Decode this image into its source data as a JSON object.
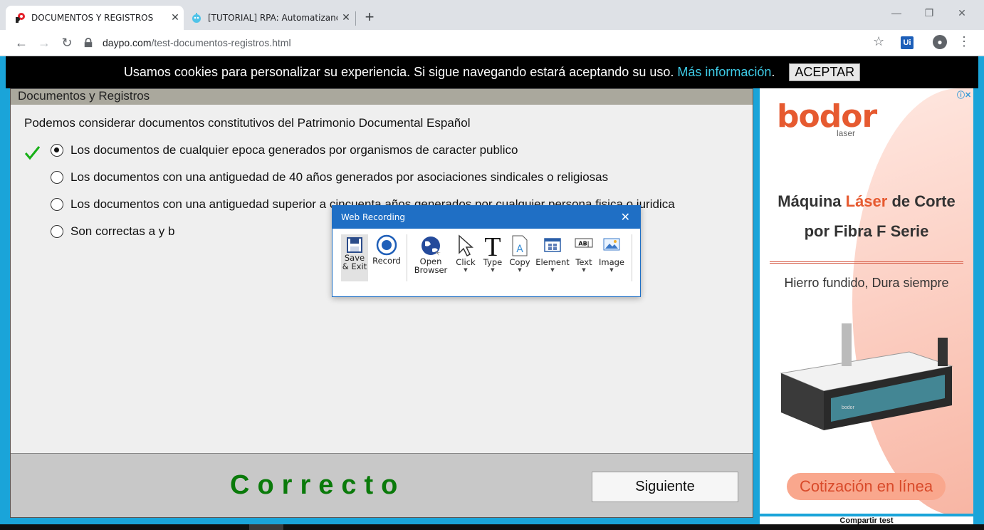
{
  "browser": {
    "tabs": [
      {
        "title": "DOCUMENTOS Y REGISTROS",
        "active": true
      },
      {
        "title": "[TUTORIAL] RPA: Automatizando",
        "active": false
      }
    ],
    "new_tab": "+",
    "url_host": "daypo.com",
    "url_path": "/test-documentos-registros.html",
    "ext_label": "Ui"
  },
  "cookie_bar": {
    "text": "Usamos cookies para personalizar su experiencia. Si sigue navegando estará aceptando su uso.",
    "more_link": "Más información",
    "period": ".",
    "accept_label": "ACEPTAR"
  },
  "quiz": {
    "header": "Documentos y Registros",
    "question": "Podemos considerar documentos constitutivos del Patrimonio Documental Español",
    "options": [
      "Los documentos de cualquier epoca generados por organismos de caracter publico",
      "Los documentos con una antiguedad de 40 años generados por asociaciones sindicales o religiosas",
      "Los documentos con una antiguedad superior a cincuenta años generados por cualquier persona fisica o juridica",
      "Son correctas a y b"
    ],
    "selected_index": 0,
    "result": "Correcto",
    "next_label": "Siguiente"
  },
  "ad": {
    "brand": "bodor",
    "brand_sub": "laser",
    "headline_1a": "Máquina ",
    "headline_1b": "Láser",
    "headline_1c": " de Corte",
    "headline_2": "por Fibra F Serie",
    "subtitle": "Hierro fundido, Dura siempre",
    "cta": "Cotización en línea",
    "accent_color": "#e65a30",
    "machine_label": "bodor"
  },
  "share_label": "Compartir test",
  "recorder": {
    "title": "Web Recording",
    "tools": {
      "save": "Save & Exit",
      "record": "Record",
      "open_browser": "Open Browser",
      "click": "Click",
      "type": "Type",
      "copy": "Copy",
      "element": "Element",
      "text": "Text",
      "image": "Image"
    }
  }
}
